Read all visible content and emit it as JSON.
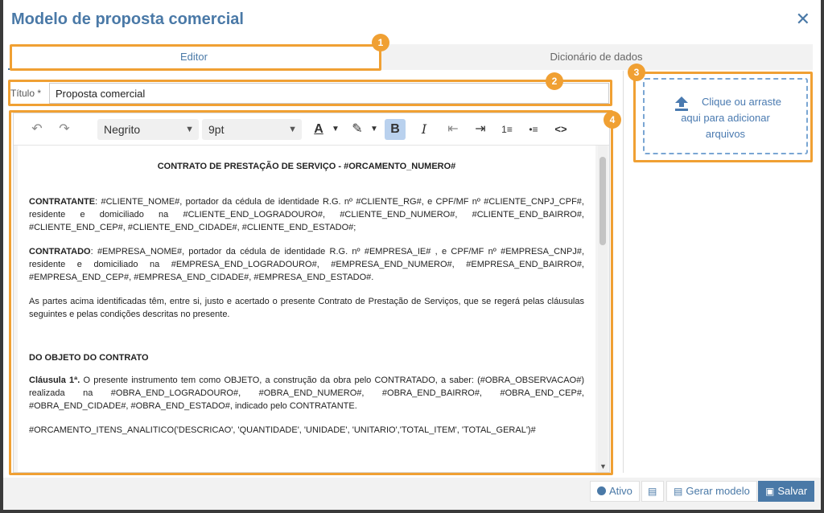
{
  "modal": {
    "title": "Modelo de proposta comercial",
    "close": "✕"
  },
  "tabs": [
    {
      "label": "Editor",
      "active": true
    },
    {
      "label": "Dicionário de dados",
      "active": false
    }
  ],
  "title_field": {
    "label": "Título *",
    "value": "Proposta comercial"
  },
  "toolbar": {
    "undo": "↶",
    "redo": "↷",
    "font": "Negrito",
    "size": "9pt",
    "text_color": "A",
    "highlight": "✎",
    "bold": "B",
    "italic": "I",
    "outdent": "⇤",
    "indent": "⇥",
    "ordered_list": "1≡",
    "bullet_list": "•≡",
    "code": "<>"
  },
  "document": {
    "title": "CONTRATO DE PRESTAÇÃO DE SERVIÇO - #ORCAMENTO_NUMERO#",
    "contratante_label": "CONTRATANTE",
    "contratante_text": ": #CLIENTE_NOME#, portador da cédula de identidade R.G. nº #CLIENTE_RG#, e CPF/MF nº #CLIENTE_CNPJ_CPF#, residente e domiciliado na #CLIENTE_END_LOGRADOURO#, #CLIENTE_END_NUMERO#, #CLIENTE_END_BAIRRO#, #CLIENTE_END_CEP#, #CLIENTE_END_CIDADE#, #CLIENTE_END_ESTADO#;",
    "contratado_label": "CONTRATADO",
    "contratado_text": ": #EMPRESA_NOME#, portador da cédula de identidade R.G. nº #EMPRESA_IE# , e CPF/MF nº #EMPRESA_CNPJ#, residente e domiciliado na #EMPRESA_END_LOGRADOURO#, #EMPRESA_END_NUMERO#, #EMPRESA_END_BAIRRO#, #EMPRESA_END_CEP#, #EMPRESA_END_CIDADE#, #EMPRESA_END_ESTADO#.",
    "partes_text": "As partes acima identificadas têm, entre si, justo e acertado o presente Contrato de Prestação de Serviços, que se regerá pelas cláusulas seguintes e pelas condições descritas no presente.",
    "objeto_heading": "DO OBJETO DO CONTRATO",
    "clausula_label": "Cláusula 1ª.",
    "clausula_text": " O presente instrumento tem como OBJETO, a construção da obra pelo CONTRATADO, a saber: (#OBRA_OBSERVACAO#) realizada na #OBRA_END_LOGRADOURO#, #OBRA_END_NUMERO#, #OBRA_END_BAIRRO#, #OBRA_END_CEP#, #OBRA_END_CIDADE#, #OBRA_END_ESTADO#, indicado pelo CONTRATANTE.",
    "itens_text": "#ORCAMENTO_ITENS_ANALITICO('DESCRICAO', 'QUANTIDADE', 'UNIDADE', 'UNITARIO','TOTAL_ITEM', 'TOTAL_GERAL')#"
  },
  "dropzone": {
    "line1": "Clique ou arraste",
    "line2": "aqui para adicionar",
    "line3": "arquivos"
  },
  "callouts": {
    "one": "1",
    "two": "2",
    "three": "3",
    "four": "4"
  },
  "footer": {
    "ativo": "Ativo",
    "gerar": "Gerar modelo",
    "salvar": "Salvar"
  },
  "colors": {
    "accent": "#4a79a7",
    "highlight": "#f0a033"
  }
}
